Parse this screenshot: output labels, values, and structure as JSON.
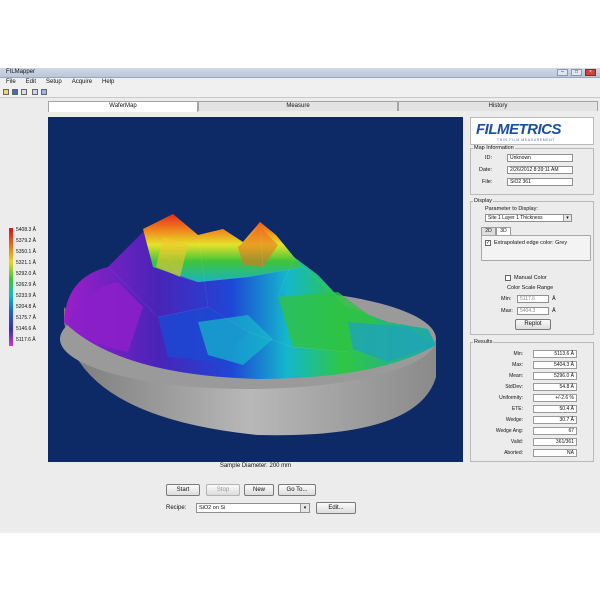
{
  "window": {
    "title": "FILMapper"
  },
  "menu": [
    "File",
    "Edit",
    "Setup",
    "Acquire",
    "Help"
  ],
  "tabs": [
    {
      "label": "WaferMap",
      "active": true
    },
    {
      "label": "Measure",
      "active": false
    },
    {
      "label": "History",
      "active": false
    }
  ],
  "legend": {
    "values": [
      "5408.3 Å",
      "5379.2 Å",
      "5350.1 Å",
      "5321.1 Å",
      "5292.0 Å",
      "5262.9 Å",
      "5233.9 Å",
      "5204.8 Å",
      "5175.7 Å",
      "5146.6 Å",
      "5117.6 Å"
    ]
  },
  "map": {
    "caption": "Sample Diameter: 200 mm"
  },
  "logo": {
    "name": "FILMETRICS",
    "tagline": "THIN-FILM MEASUREMENT"
  },
  "map_info": {
    "title": "Map Information",
    "id_label": "ID:",
    "id_value": "Unknown",
    "date_label": "Date:",
    "date_value": "2/26/2012 8:39:11 AM",
    "file_label": "File:",
    "file_value": "SiO2 361"
  },
  "display": {
    "title": "Display",
    "param_label": "Parameter to Display:",
    "param_value": "Site 1 Layer 1 Thickness",
    "tab_2d": "2D",
    "tab_3d": "3D",
    "interp_label": "Extrapolated edge color: Grey",
    "manual_color_label": "Manual Color",
    "color_scale_label": "Color Scale Range",
    "min_label": "Min:",
    "min_value": "5117.6",
    "min_unit": "Å",
    "max_label": "Max:",
    "max_value": "5404.3",
    "max_unit": "Å",
    "replot_label": "Replot"
  },
  "results": {
    "title": "Results",
    "rows": [
      {
        "label": "Min:",
        "value": "5113.6 Å"
      },
      {
        "label": "Max:",
        "value": "5404.3 Å"
      },
      {
        "label": "Mean:",
        "value": "5296.0 Å"
      },
      {
        "label": "StdDev:",
        "value": "54.8 Å"
      },
      {
        "label": "Uniformity:",
        "value": "+/-2.6 %"
      },
      {
        "label": "ETE:",
        "value": "50.4 Å"
      },
      {
        "label": "Wedge:",
        "value": "30.7 Å"
      },
      {
        "label": "Wedge Ang:",
        "value": "67"
      },
      {
        "label": "Valid:",
        "value": "361/361"
      },
      {
        "label": "Aborted:",
        "value": "NA"
      }
    ]
  },
  "controls": {
    "start": "Start",
    "stop": "Stop",
    "new": "New",
    "goto": "Go To...",
    "recipe_label": "Recipe:",
    "recipe_value": "SiO2 on Si",
    "edit": "Edit..."
  },
  "colors": {
    "map_background": "#0d2a66",
    "accent": "#1b4fa0"
  }
}
